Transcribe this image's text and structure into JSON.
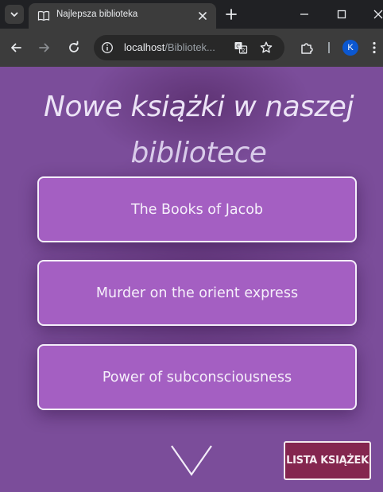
{
  "browser": {
    "tab": {
      "title": "Najlepsza biblioteka"
    },
    "address_bar": {
      "host": "localhost",
      "path": "/Bibliotek..."
    },
    "profile_initial": "K"
  },
  "page": {
    "heading_line1": "Nowe książki w naszej",
    "heading_line2": "bibliotece",
    "books": [
      "The Books of Jacob",
      "Murder on the orient express",
      "Power of subconsciousness"
    ],
    "list_button_label": "LISTA KSIĄŻEK"
  },
  "colors": {
    "page_background": "#7b4d9a",
    "card_background": "#a45fc2",
    "list_button_background": "#84264f"
  },
  "icons": {
    "tab_search": "chevron-down-icon",
    "favicon": "book-icon",
    "tab_close": "close-icon",
    "new_tab": "plus-icon",
    "window": [
      "minimize-icon",
      "maximize-icon",
      "close-window-icon"
    ],
    "navigation": [
      "back-arrow-icon",
      "forward-arrow-icon",
      "reload-icon"
    ],
    "omnibox": [
      "info-icon",
      "translate-icon",
      "star-icon"
    ],
    "toolbar": [
      "extensions-icon",
      "more-menu-icon"
    ],
    "scroll": "chevron-down-large-icon"
  }
}
